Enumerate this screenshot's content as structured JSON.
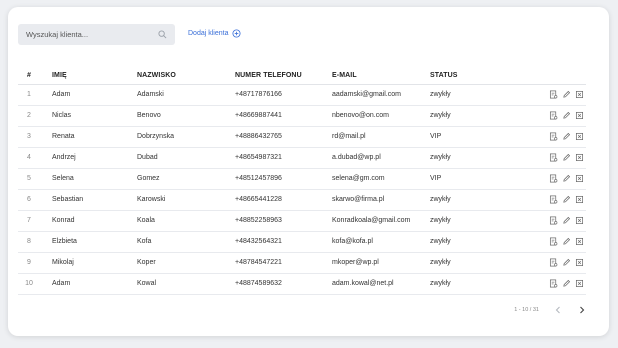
{
  "search": {
    "placeholder": "Wyszukaj klienta..."
  },
  "add_client_label": "Dodaj klienta",
  "columns": [
    "#",
    "IMIĘ",
    "NAZWISKO",
    "NUMER TELEFONU",
    "E-MAIL",
    "STATUS"
  ],
  "rows": [
    {
      "num": "1",
      "first": "Adam",
      "last": "Adamski",
      "phone": "+48717876166",
      "email": "aadamski@gmail.com",
      "status": "zwykły"
    },
    {
      "num": "2",
      "first": "Niclas",
      "last": "Benovo",
      "phone": "+48669887441",
      "email": "nbenovo@on.com",
      "status": "zwykły"
    },
    {
      "num": "3",
      "first": "Renata",
      "last": "Dobrzynska",
      "phone": "+48886432765",
      "email": "rd@mail.pl",
      "status": "VIP"
    },
    {
      "num": "4",
      "first": "Andrzej",
      "last": "Dubad",
      "phone": "+48654987321",
      "email": "a.dubad@wp.pl",
      "status": "zwykły"
    },
    {
      "num": "5",
      "first": "Selena",
      "last": "Gomez",
      "phone": "+48512457896",
      "email": "selena@gm.com",
      "status": "VIP"
    },
    {
      "num": "6",
      "first": "Sebastian",
      "last": "Karowski",
      "phone": "+48665441228",
      "email": "skarwo@firma.pl",
      "status": "zwykły"
    },
    {
      "num": "7",
      "first": "Konrad",
      "last": "Koala",
      "phone": "+48852258963",
      "email": "Konradkoala@gmail.com",
      "status": "zwykły"
    },
    {
      "num": "8",
      "first": "Elzbieta",
      "last": "Kofa",
      "phone": "+48432564321",
      "email": "kofa@kofa.pl",
      "status": "zwykły"
    },
    {
      "num": "9",
      "first": "Mikolaj",
      "last": "Koper",
      "phone": "+48784547221",
      "email": "mkoper@wp.pl",
      "status": "zwykły"
    },
    {
      "num": "10",
      "first": "Adam",
      "last": "Kowal",
      "phone": "+48874589632",
      "email": "adam.kowal@net.pl",
      "status": "zwykły"
    }
  ],
  "row_actions": [
    "details-icon",
    "edit-icon",
    "delete-icon"
  ],
  "pagination": {
    "range": "1 - 10 / 31"
  },
  "colors": {
    "accent": "#3a6fd8",
    "search_bg": "#e9ebef",
    "page_bg": "#eef0f3"
  }
}
